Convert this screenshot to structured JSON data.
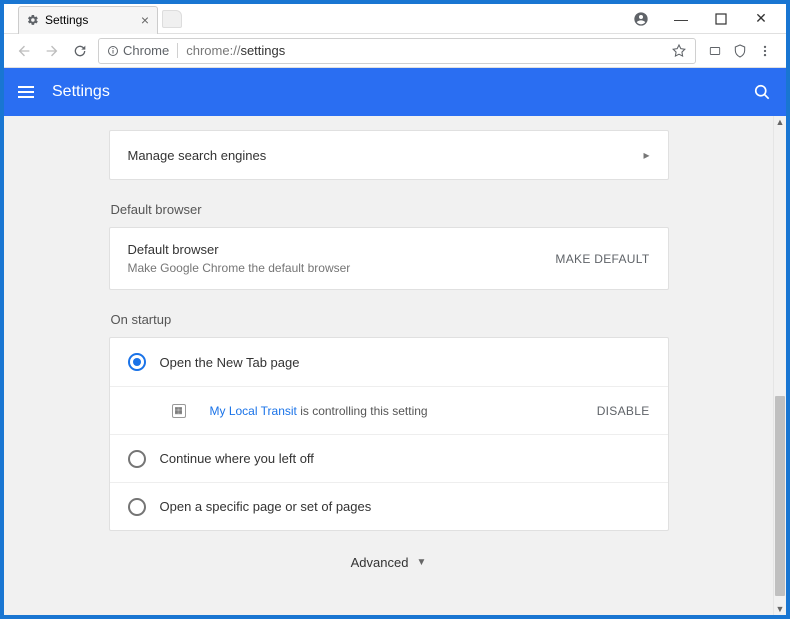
{
  "window": {
    "tab_title": "Settings",
    "user_icon": "account-circle",
    "minimize": "—",
    "maximize": "☐",
    "close": "✕"
  },
  "addrbar": {
    "secure_label": "Chrome",
    "url_scheme": "chrome://",
    "url_path": "settings"
  },
  "header": {
    "title": "Settings"
  },
  "search_engines": {
    "label": "Manage search engines"
  },
  "default_browser": {
    "section": "Default browser",
    "title": "Default browser",
    "subtitle": "Make Google Chrome the default browser",
    "button": "MAKE DEFAULT"
  },
  "startup": {
    "section": "On startup",
    "options": [
      {
        "label": "Open the New Tab page",
        "checked": true
      },
      {
        "label": "Continue where you left off",
        "checked": false
      },
      {
        "label": "Open a specific page or set of pages",
        "checked": false
      }
    ],
    "controlled": {
      "ext_name": "My Local Transit",
      "suffix": " is controlling this setting",
      "disable": "DISABLE"
    }
  },
  "advanced": {
    "label": "Advanced"
  }
}
